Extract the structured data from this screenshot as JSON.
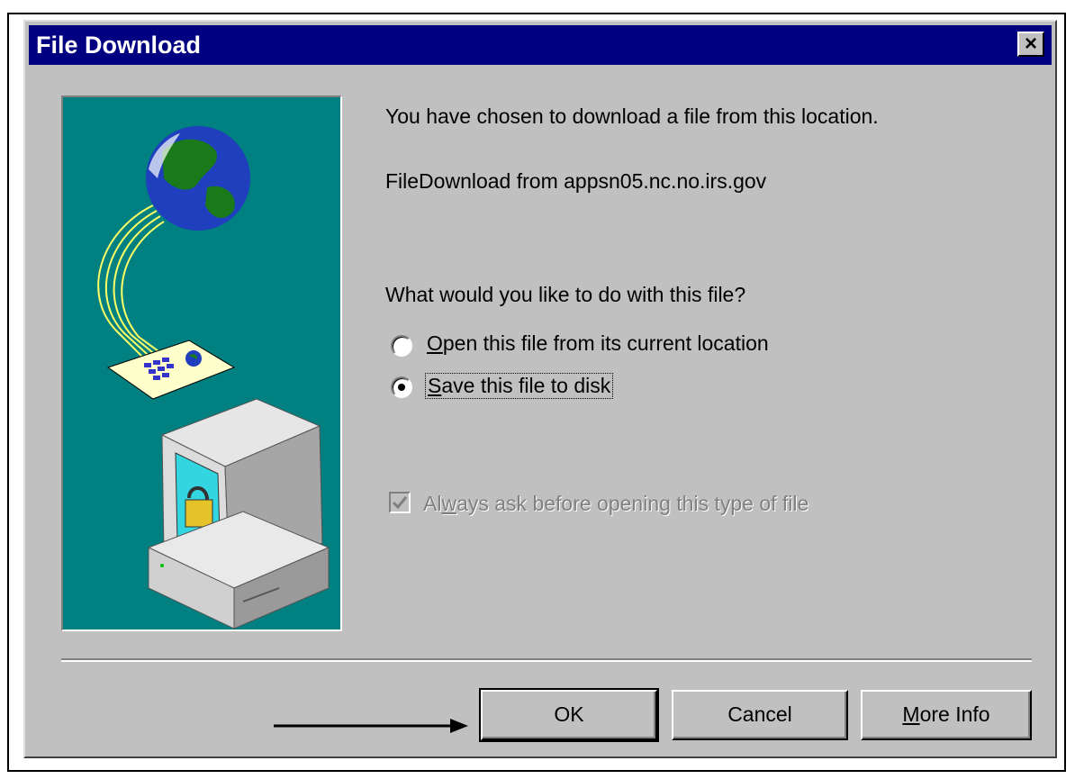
{
  "dialog": {
    "title": "File Download",
    "close_label": "×"
  },
  "message": {
    "intro": "You have chosen to download a file from this location.",
    "source": "FileDownload from appsn05.nc.no.irs.gov",
    "question": "What would you like to do with this file?"
  },
  "options": {
    "open": {
      "mnemonic": "O",
      "rest": "pen this file from its current location",
      "selected": false
    },
    "save": {
      "mnemonic": "S",
      "rest": "ave this file to disk",
      "selected": true
    }
  },
  "always_ask": {
    "pre": "Al",
    "mnemonic": "w",
    "rest": "ays ask before opening this type of file",
    "checked": true,
    "enabled": false
  },
  "buttons": {
    "ok": "OK",
    "cancel": "Cancel",
    "more_info_mnemonic": "M",
    "more_info_rest": "ore Info"
  },
  "colors": {
    "titlebar": "#000080",
    "dialog_bg": "#c0c0c0",
    "art_bg": "#008080"
  }
}
